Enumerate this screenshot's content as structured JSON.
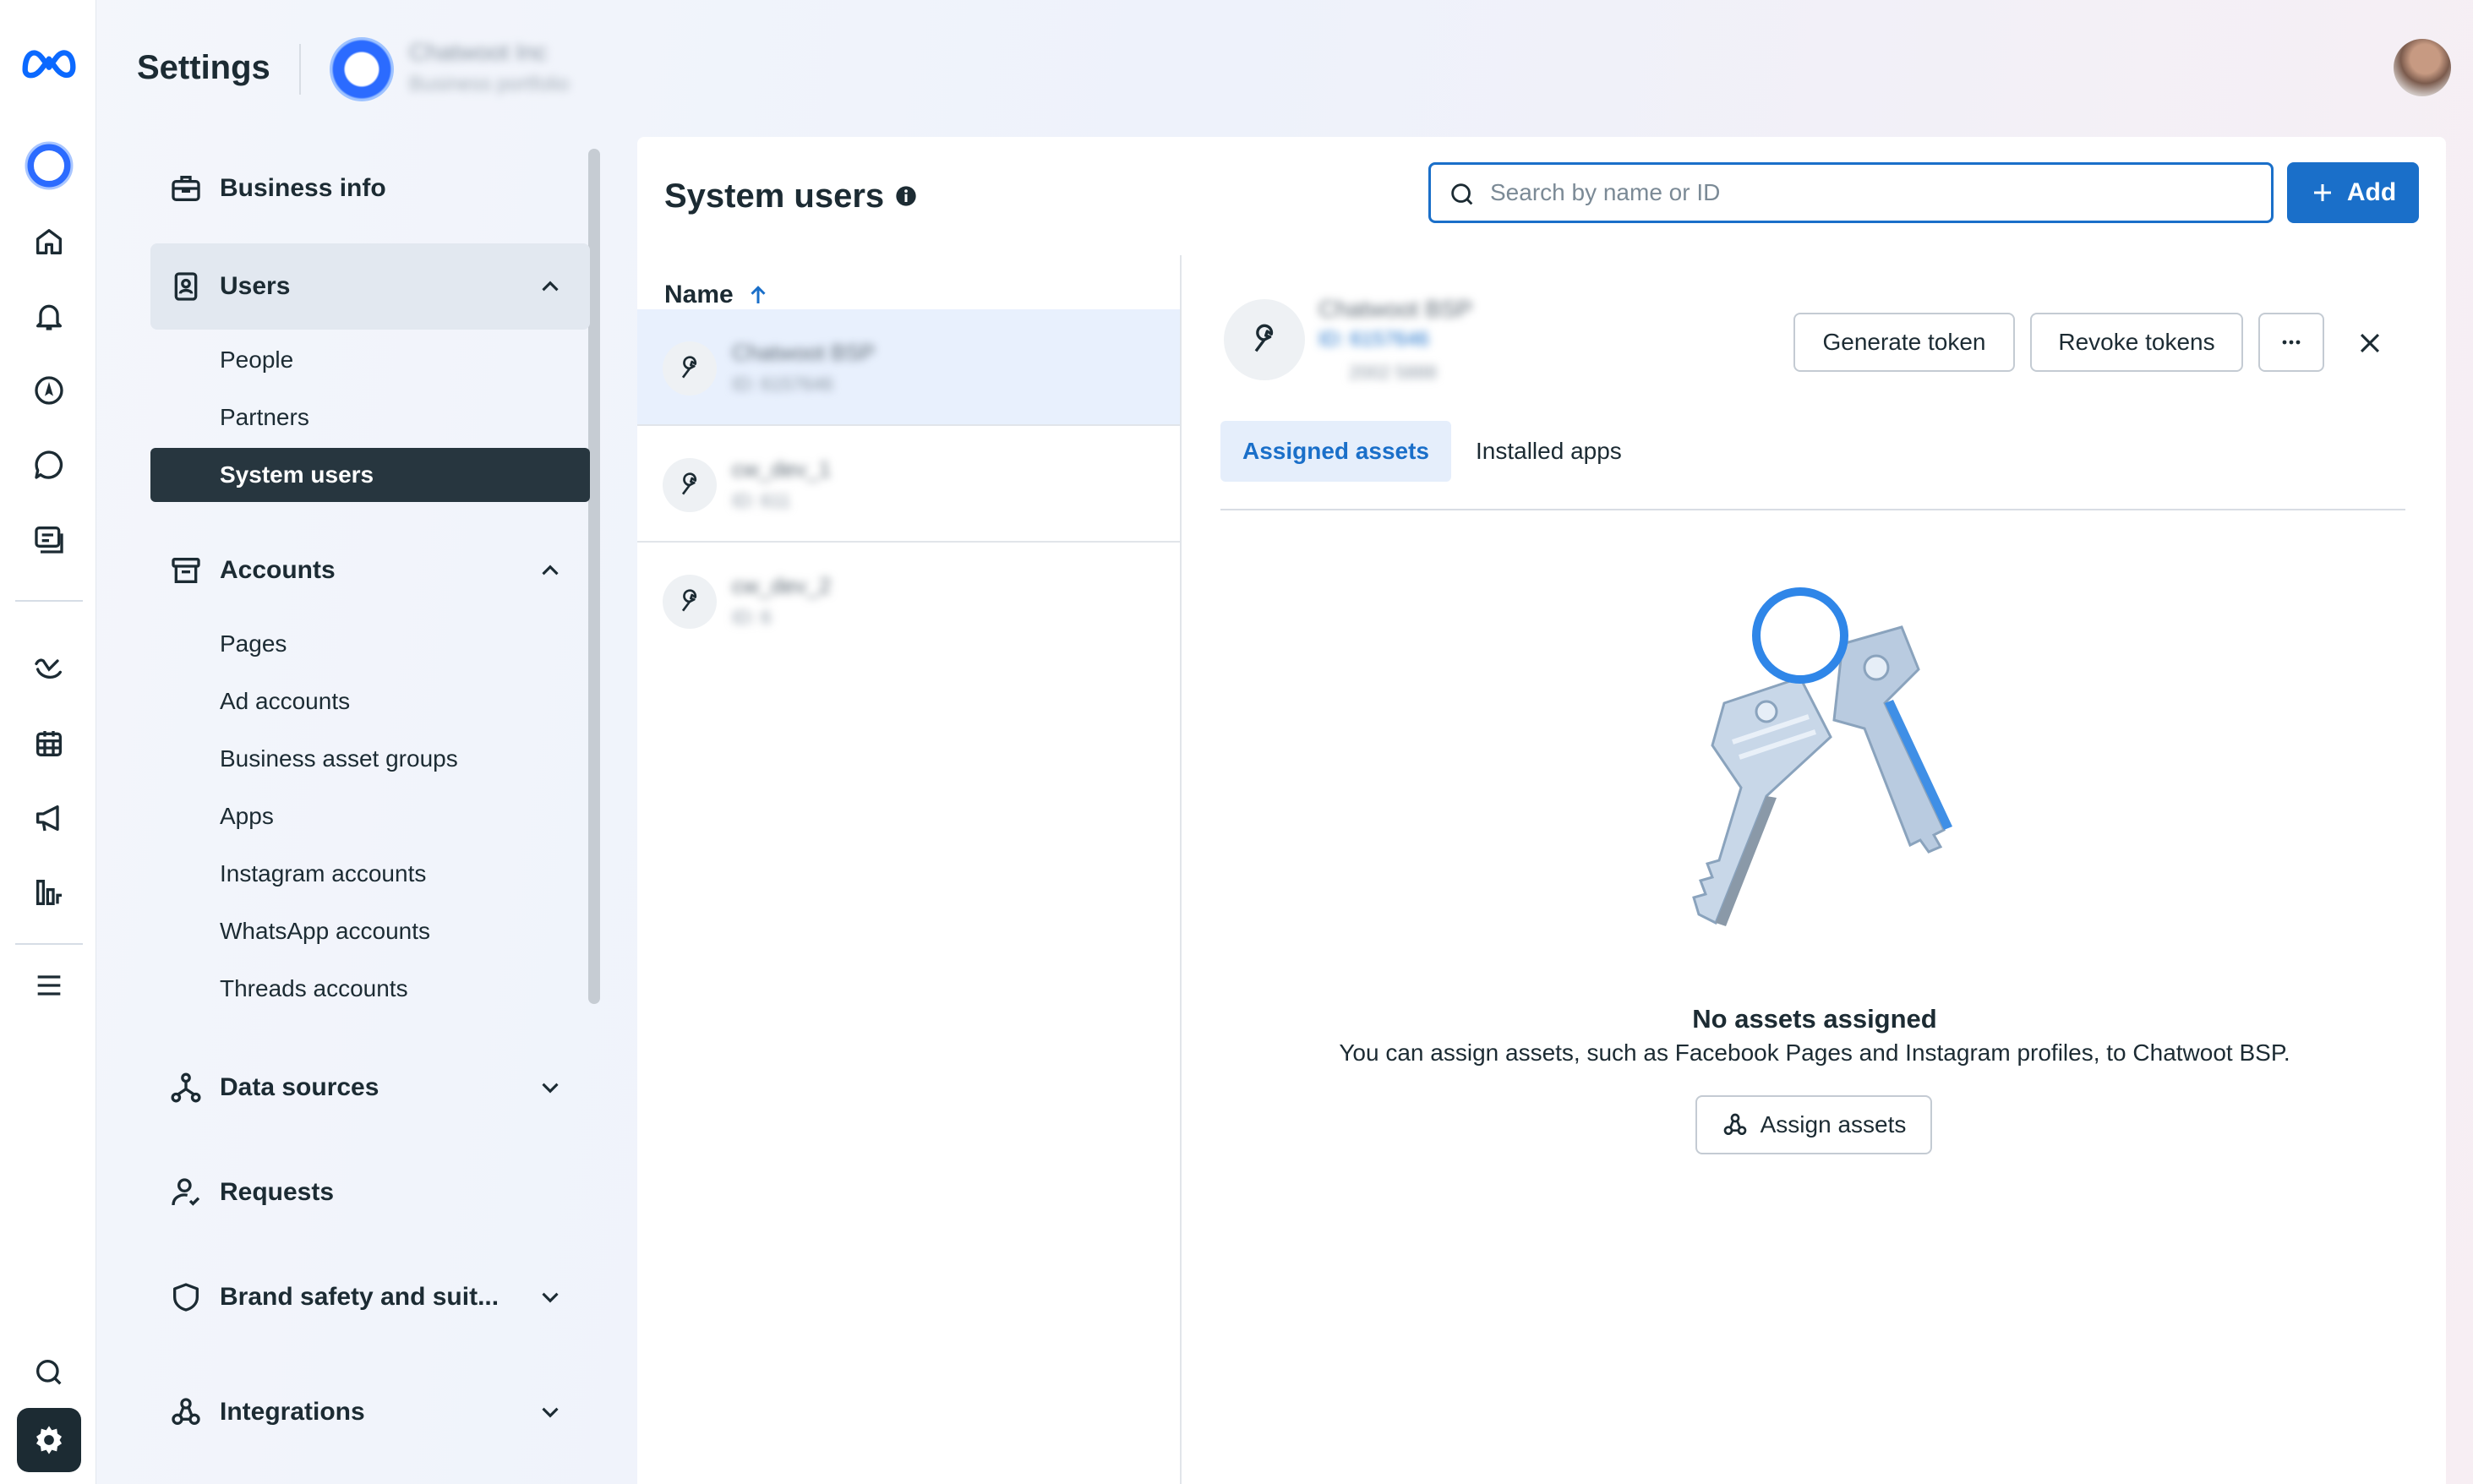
{
  "app": {
    "title": "Settings",
    "portfolio_name": "Chatwoot Inc",
    "portfolio_sub": "Business portfolio"
  },
  "rail": {
    "icons": [
      "meta-logo-icon",
      "portfolio-icon",
      "home-icon",
      "bell-icon",
      "compass-icon",
      "chat-icon",
      "content-icon",
      "planner-icon",
      "calendar-icon",
      "megaphone-icon",
      "insights-icon",
      "menu-icon",
      "search-icon",
      "gear-icon"
    ]
  },
  "nav": {
    "business_info": "Business info",
    "users": "Users",
    "users_items": [
      "People",
      "Partners",
      "System users"
    ],
    "accounts": "Accounts",
    "accounts_items": [
      "Pages",
      "Ad accounts",
      "Business asset groups",
      "Apps",
      "Instagram accounts",
      "WhatsApp accounts",
      "Threads accounts"
    ],
    "data_sources": "Data sources",
    "requests": "Requests",
    "brand_safety": "Brand safety and suit...",
    "integrations": "Integrations"
  },
  "main": {
    "title": "System users",
    "search_placeholder": "Search by name or ID",
    "add_label": "Add",
    "list_header": "Name",
    "rows": [
      {
        "name": "Chatwoot BSP",
        "id": "ID: 6157646"
      },
      {
        "name": "cw_dev_1",
        "id": "ID: 611"
      },
      {
        "name": "cw_dev_2",
        "id": "ID: 6"
      }
    ]
  },
  "detail": {
    "name": "Chatwoot BSP",
    "id": "ID: 6157646",
    "meta": "2002 5888",
    "generate_token": "Generate token",
    "revoke_tokens": "Revoke tokens",
    "tabs": [
      "Assigned assets",
      "Installed apps"
    ],
    "empty_title": "No assets assigned",
    "empty_desc": "You can assign assets, such as Facebook Pages and Instagram profiles, to Chatwoot BSP.",
    "assign_assets": "Assign assets"
  },
  "colors": {
    "accent": "#1a6fc9",
    "nav_selected": "#27363f",
    "text": "#1c2b33"
  }
}
